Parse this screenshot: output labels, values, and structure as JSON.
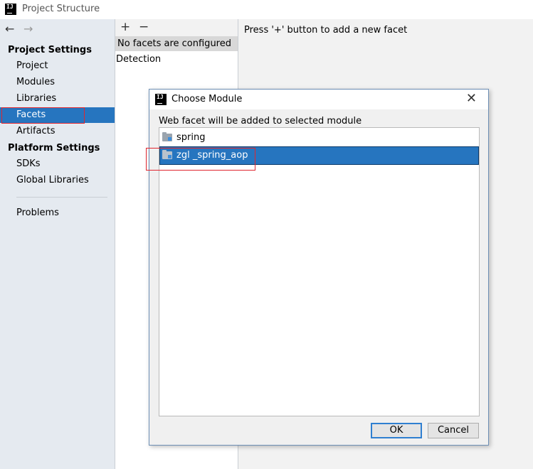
{
  "window": {
    "title": "Project Structure",
    "app_icon_text": "IJ"
  },
  "sidebar": {
    "back_icon": "←",
    "forward_icon": "→",
    "project_settings_header": "Project Settings",
    "project_items": [
      "Project",
      "Modules",
      "Libraries",
      "Facets",
      "Artifacts"
    ],
    "platform_settings_header": "Platform Settings",
    "platform_items": [
      "SDKs",
      "Global Libraries"
    ],
    "problems_label": "Problems",
    "selected_item": "Facets"
  },
  "facets": {
    "add_icon": "+",
    "remove_icon": "−",
    "empty_text": "No facets are configured",
    "detection_label": "Detection"
  },
  "main": {
    "hint": "Press '+' button to add a new facet"
  },
  "dialog": {
    "title": "Choose Module",
    "icon_text": "IJ",
    "close_icon": "✕",
    "message": "Web facet will be added to selected module",
    "modules": [
      "spring",
      "zgl _spring_aop"
    ],
    "selected_module": "zgl _spring_aop",
    "ok_label": "OK",
    "cancel_label": "Cancel"
  },
  "colors": {
    "selection": "#2675bf",
    "highlight_box": "#e0262f",
    "sidebar_bg": "#e5eaf0"
  }
}
